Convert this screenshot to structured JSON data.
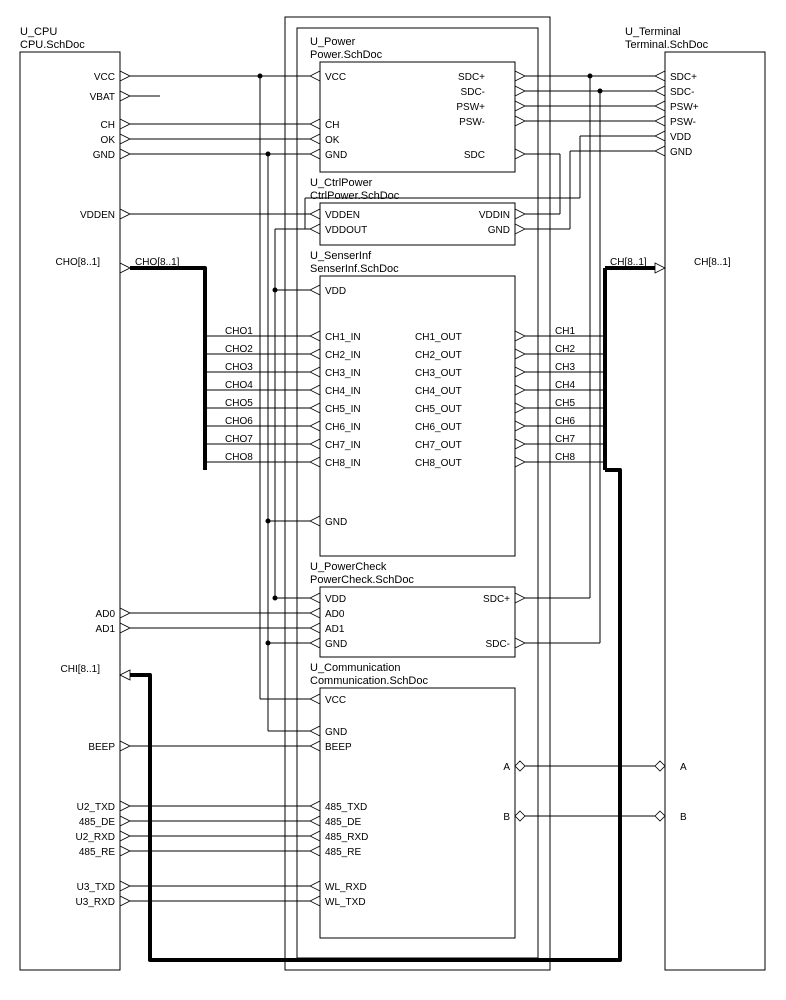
{
  "blocks": {
    "cpu": {
      "name": "U_CPU",
      "file": "CPU.SchDoc"
    },
    "power": {
      "name": "U_Power",
      "file": "Power.SchDoc"
    },
    "ctrlpower": {
      "name": "U_CtrlPower",
      "file": "CtrlPower.SchDoc"
    },
    "senserinf": {
      "name": "U_SenserInf",
      "file": "SenserInf.SchDoc"
    },
    "powercheck": {
      "name": "U_PowerCheck",
      "file": "PowerCheck.SchDoc"
    },
    "communication": {
      "name": "U_Communication",
      "file": "Communication.SchDoc"
    },
    "terminal": {
      "name": "U_Terminal",
      "file": "Terminal.SchDoc"
    }
  },
  "cpu_pins": {
    "vcc": "VCC",
    "vbat": "VBAT",
    "ch": "CH",
    "ok": "OK",
    "gnd": "GND",
    "vdden": "VDDEN",
    "cho_bus": "CHO[8..1]",
    "cho1": "CHO1",
    "cho2": "CHO2",
    "cho3": "CHO3",
    "cho4": "CHO4",
    "cho5": "CHO5",
    "cho6": "CHO6",
    "cho7": "CHO7",
    "cho8": "CHO8",
    "ad0": "AD0",
    "ad1": "AD1",
    "chi_bus": "CHI[8..1]",
    "beep": "BEEP",
    "u2_txd": "U2_TXD",
    "485_de": "485_DE",
    "u2_rxd": "U2_RXD",
    "485_re": "485_RE",
    "u3_txd": "U3_TXD",
    "u3_rxd": "U3_RXD"
  },
  "power_pins": {
    "vcc": "VCC",
    "ch": "CH",
    "ok": "OK",
    "gnd": "GND",
    "sdcp": "SDC+",
    "sdcm": "SDC-",
    "pswp": "PSW+",
    "pswm": "PSW-",
    "sdc": "SDC"
  },
  "ctrlpower_pins": {
    "vdden": "VDDEN",
    "vddout": "VDDOUT",
    "vddin": "VDDIN",
    "gnd": "GND"
  },
  "senserinf_pins": {
    "vdd": "VDD",
    "ch1_in": "CH1_IN",
    "ch2_in": "CH2_IN",
    "ch3_in": "CH3_IN",
    "ch4_in": "CH4_IN",
    "ch5_in": "CH5_IN",
    "ch6_in": "CH6_IN",
    "ch7_in": "CH7_IN",
    "ch8_in": "CH8_IN",
    "ch1_out": "CH1_OUT",
    "ch2_out": "CH2_OUT",
    "ch3_out": "CH3_OUT",
    "ch4_out": "CH4_OUT",
    "ch5_out": "CH5_OUT",
    "ch6_out": "CH6_OUT",
    "ch7_out": "CH7_OUT",
    "ch8_out": "CH8_OUT",
    "gnd": "GND"
  },
  "senser_mid_left": {
    "cho1": "CHO1",
    "cho2": "CHO2",
    "cho3": "CHO3",
    "cho4": "CHO4",
    "cho5": "CHO5",
    "cho6": "CHO6",
    "cho7": "CHO7",
    "cho8": "CHO8"
  },
  "senser_mid_right": {
    "ch1": "CH1",
    "ch2": "CH2",
    "ch3": "CH3",
    "ch4": "CH4",
    "ch5": "CH5",
    "ch6": "CH6",
    "ch7": "CH7",
    "ch8": "CH8"
  },
  "powercheck_pins": {
    "vdd": "VDD",
    "ad0": "AD0",
    "ad1": "AD1",
    "gnd": "GND",
    "sdcp": "SDC+",
    "sdcm": "SDC-"
  },
  "comm_pins": {
    "vcc": "VCC",
    "gnd": "GND",
    "beep": "BEEP",
    "485_txd": "485_TXD",
    "485_de": "485_DE",
    "485_rxd": "485_RXD",
    "485_re": "485_RE",
    "wl_rxd": "WL_RXD",
    "wl_txd": "WL_TXD",
    "a": "A",
    "b": "B"
  },
  "terminal_pins": {
    "sdcp": "SDC+",
    "sdcm": "SDC-",
    "pswp": "PSW+",
    "pswm": "PSW-",
    "vdd": "VDD",
    "gnd": "GND",
    "ch_bus": "CH[8..1]",
    "a": "A",
    "b": "B"
  },
  "ch_bus_label": "CH[8..1]"
}
